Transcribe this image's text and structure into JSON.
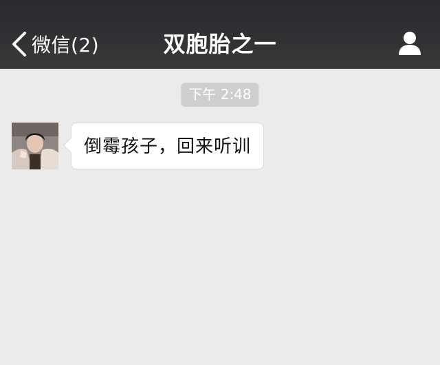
{
  "nav": {
    "back_label": "微信(2)",
    "back_icon": "chevron-left-icon",
    "title": "双胞胎之一",
    "profile_icon": "person-icon",
    "background": "#333336"
  },
  "timestamp": "下午 2:48",
  "messages": [
    {
      "direction": "incoming",
      "avatar_icon": "user-avatar",
      "text": "倒霉孩子，回来听训"
    }
  ],
  "colors": {
    "chat_background": "#ebebeb",
    "bubble": "#ffffff",
    "timestamp_pill": "#cecece"
  }
}
